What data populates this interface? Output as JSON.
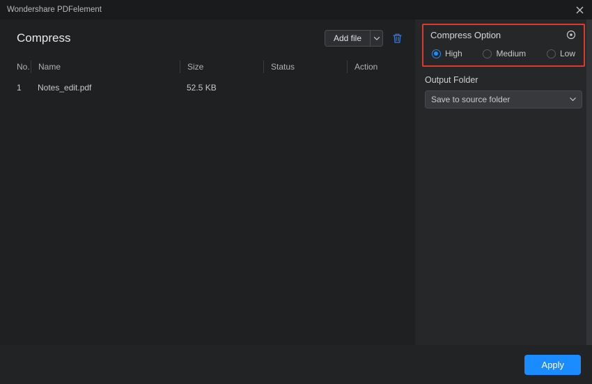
{
  "titlebar": {
    "title": "Wondershare PDFelement"
  },
  "page": {
    "title": "Compress"
  },
  "toolbar": {
    "add_file": "Add file"
  },
  "table": {
    "headers": {
      "no": "No.",
      "name": "Name",
      "size": "Size",
      "status": "Status",
      "action": "Action"
    },
    "rows": [
      {
        "no": "1",
        "name": "Notes_edit.pdf",
        "size": "52.5 KB",
        "status": "",
        "action": ""
      }
    ]
  },
  "compress_option": {
    "title": "Compress Option",
    "options": {
      "high": "High",
      "medium": "Medium",
      "low": "Low"
    },
    "selected": "high"
  },
  "output": {
    "label": "Output Folder",
    "value": "Save to source folder"
  },
  "footer": {
    "apply": "Apply"
  }
}
